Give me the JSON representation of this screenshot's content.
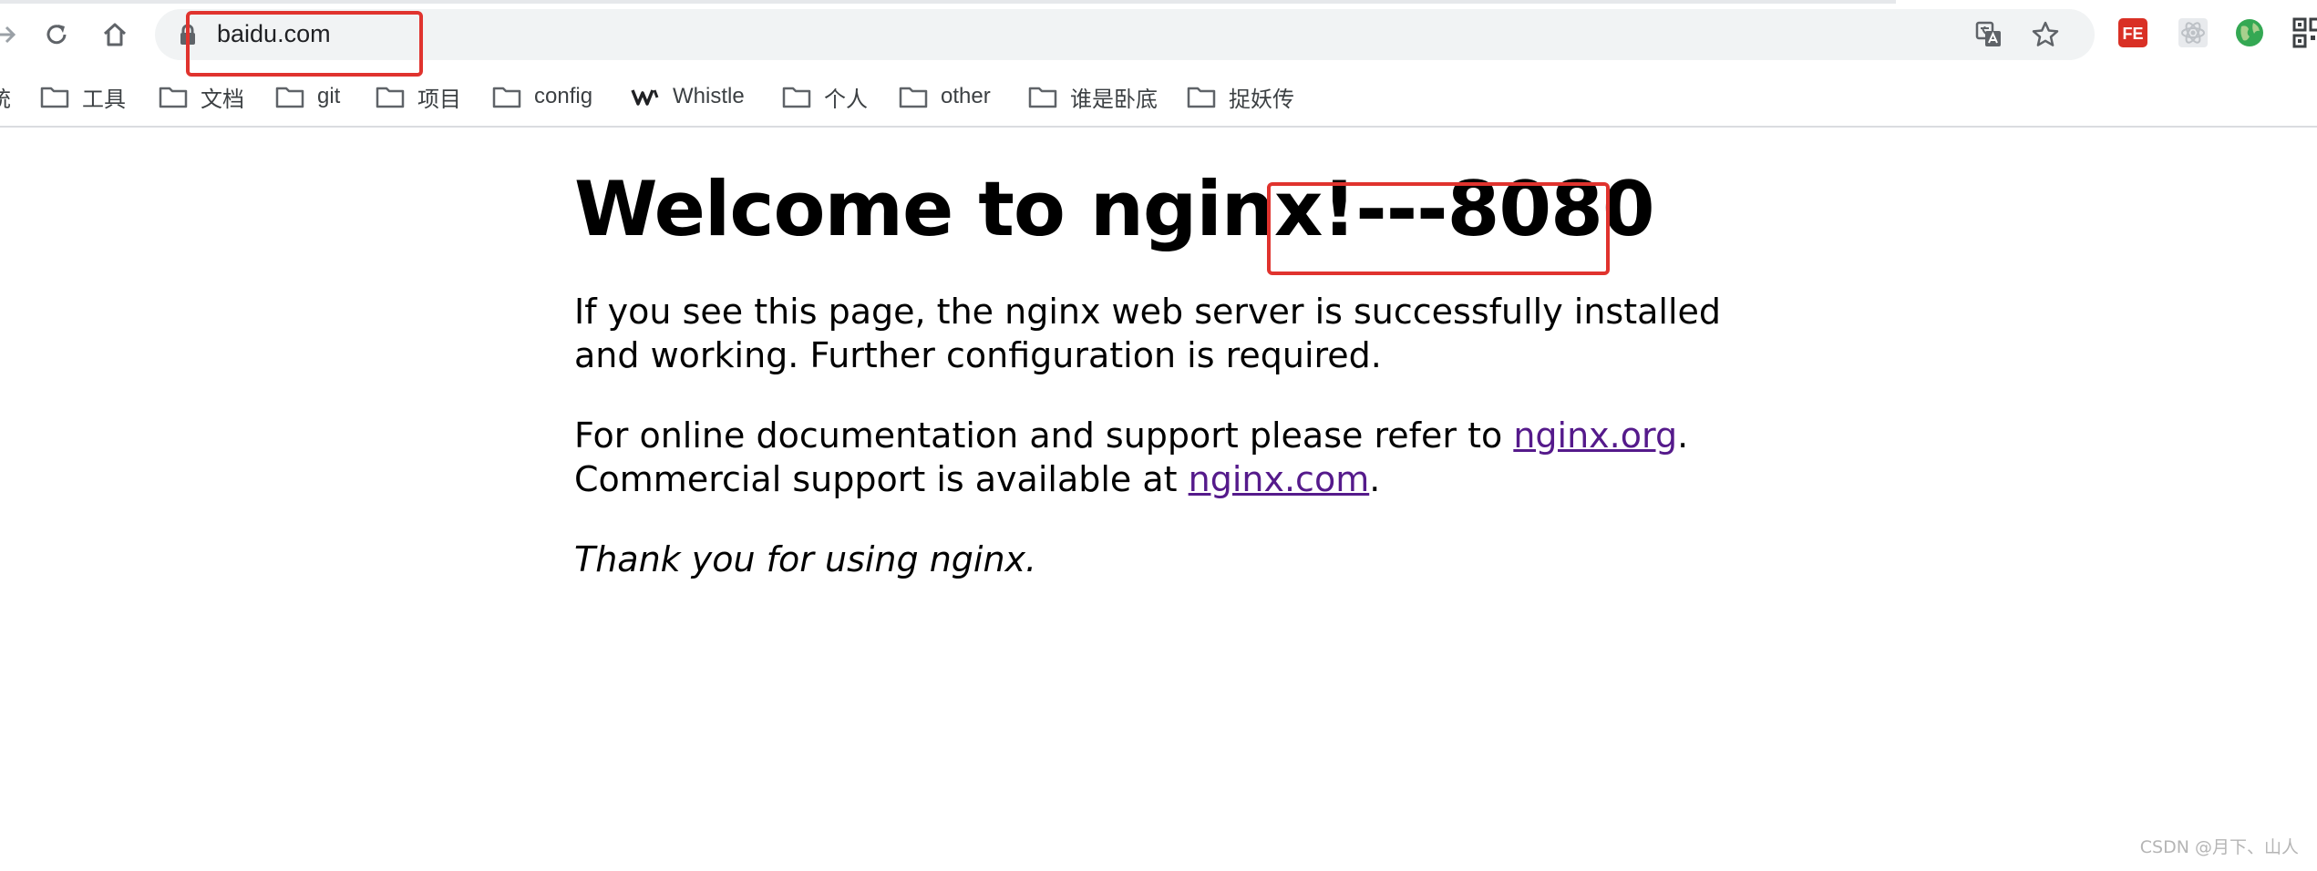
{
  "browser": {
    "url": "baidu.com",
    "bookmarks": [
      {
        "label": "统",
        "icon": "folder-icon"
      },
      {
        "label": "工具",
        "icon": "folder-icon"
      },
      {
        "label": "文档",
        "icon": "folder-icon"
      },
      {
        "label": "git",
        "icon": "folder-icon"
      },
      {
        "label": "项目",
        "icon": "folder-icon"
      },
      {
        "label": "config",
        "icon": "folder-icon"
      },
      {
        "label": "Whistle",
        "icon": "whistle-logo-icon"
      },
      {
        "label": "个人",
        "icon": "folder-icon"
      },
      {
        "label": "other",
        "icon": "folder-icon"
      },
      {
        "label": "谁是卧底",
        "icon": "folder-icon"
      },
      {
        "label": "捉妖传",
        "icon": "folder-icon"
      }
    ],
    "extensions": {
      "fe_label": "FE"
    }
  },
  "page": {
    "heading": "Welcome to nginx!---8080",
    "p1": "If you see this page, the nginx web server is successfully installed and working. Further configuration is required.",
    "p2_prefix": "For online documentation and support please refer to ",
    "link_org": "nginx.org",
    "p2_mid": ".",
    "p2_line2": "Commercial support is available at ",
    "link_com": "nginx.com",
    "p2_end": ".",
    "p3": "Thank you for using nginx."
  },
  "watermark": "CSDN @月下、山人",
  "colors": {
    "annotation": "#e0332e",
    "link": "#551a8b"
  }
}
